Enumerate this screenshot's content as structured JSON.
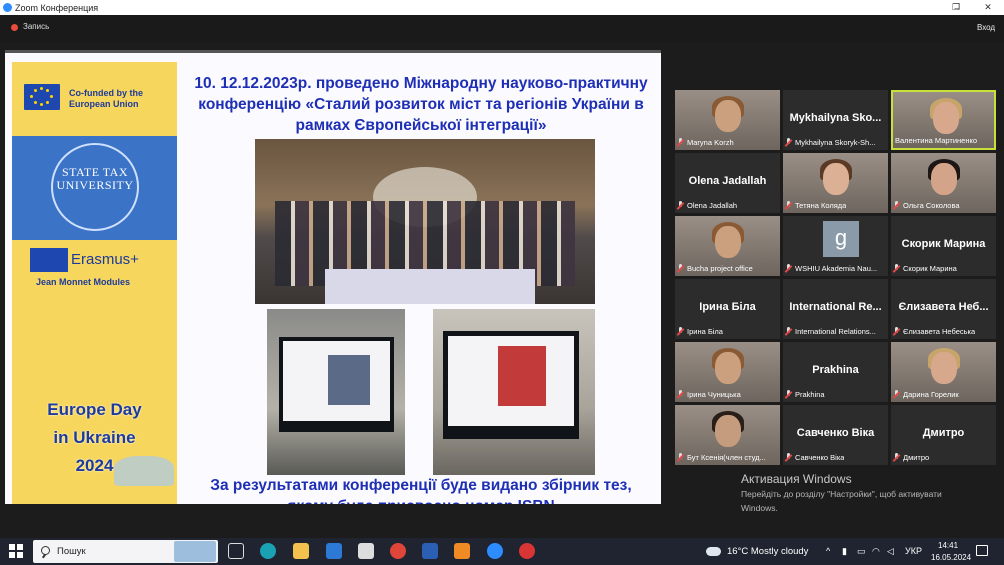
{
  "window": {
    "title": "Zoom Конференция",
    "minimize": "–",
    "maximize": "❐",
    "close": "✕"
  },
  "zoom": {
    "record_label": "Запись",
    "exit_label": "Вход"
  },
  "slide": {
    "eu_text": "Co-funded by the European Union",
    "university_text": "STATE TAX UNIVERSITY",
    "erasmus_text": "Erasmus+",
    "jean_monnet_text": "Jean Monnet Modules",
    "europe_day_line1": "Europe Day",
    "europe_day_line2": "in Ukraine",
    "europe_day_line3": "2024",
    "heading": "10. 12.12.2023р. проведено Міжнародну науково-практичну конференцію «Сталий розвиток міст та регіонів України в рамках Європейської інтеграції»",
    "footer": "За результатами конференції буде видано збірник тез, якому буде присвоєно номер ISBN"
  },
  "participants": [
    {
      "name": "Maryna Korzh",
      "big": "",
      "video": true,
      "mic_muted": true
    },
    {
      "name": "Mykhailyna Skoryk-Sh...",
      "big": "Mykhailyna Sko...",
      "video": false,
      "mic_muted": true
    },
    {
      "name": "Валентина Мартиненко",
      "big": "",
      "video": true,
      "mic_muted": false,
      "active": true
    },
    {
      "name": "Olena Jadallah",
      "big": "Olena Jadallah",
      "video": false,
      "mic_muted": true
    },
    {
      "name": "Тетяна Коляда",
      "big": "",
      "video": true,
      "mic_muted": true
    },
    {
      "name": "Ольга Соколова",
      "big": "",
      "video": true,
      "mic_muted": true
    },
    {
      "name": "Bucha project office",
      "big": "",
      "video": true,
      "mic_muted": true
    },
    {
      "name": "WSHIU Akademia Nau...",
      "big": "",
      "video": false,
      "mic_muted": true,
      "avatar": "g"
    },
    {
      "name": "Скорик Марина",
      "big": "Скорик Марина",
      "video": false,
      "mic_muted": true
    },
    {
      "name": "Ірина Біла",
      "big": "Ірина Біла",
      "video": false,
      "mic_muted": true
    },
    {
      "name": "International Relations...",
      "big": "International Re...",
      "video": false,
      "mic_muted": true
    },
    {
      "name": "Єлизавета Небеська",
      "big": "Єлизавета Неб...",
      "video": false,
      "mic_muted": true
    },
    {
      "name": "Ірина Чуницька",
      "big": "",
      "video": true,
      "mic_muted": true
    },
    {
      "name": "Prakhina",
      "big": "Prakhina",
      "video": false,
      "mic_muted": true
    },
    {
      "name": "Дарина Горелик",
      "big": "",
      "video": true,
      "mic_muted": true
    },
    {
      "name": "Бут Ксенія(член студ...",
      "big": "",
      "video": true,
      "mic_muted": true
    },
    {
      "name": "Савченко Віка",
      "big": "Савченко Віка",
      "video": false,
      "mic_muted": true
    },
    {
      "name": "Дмитро",
      "big": "Дмитро",
      "video": false,
      "mic_muted": true
    }
  ],
  "activation": {
    "title": "Активация Windows",
    "line1": "Перейдіть до розділу \"Настройки\", щоб активувати",
    "line2": "Windows."
  },
  "taskbar": {
    "search_placeholder": "Пошук",
    "weather": "16°C  Mostly cloudy",
    "language": "УКР",
    "time": "14:41",
    "date": "16.05.2024"
  }
}
